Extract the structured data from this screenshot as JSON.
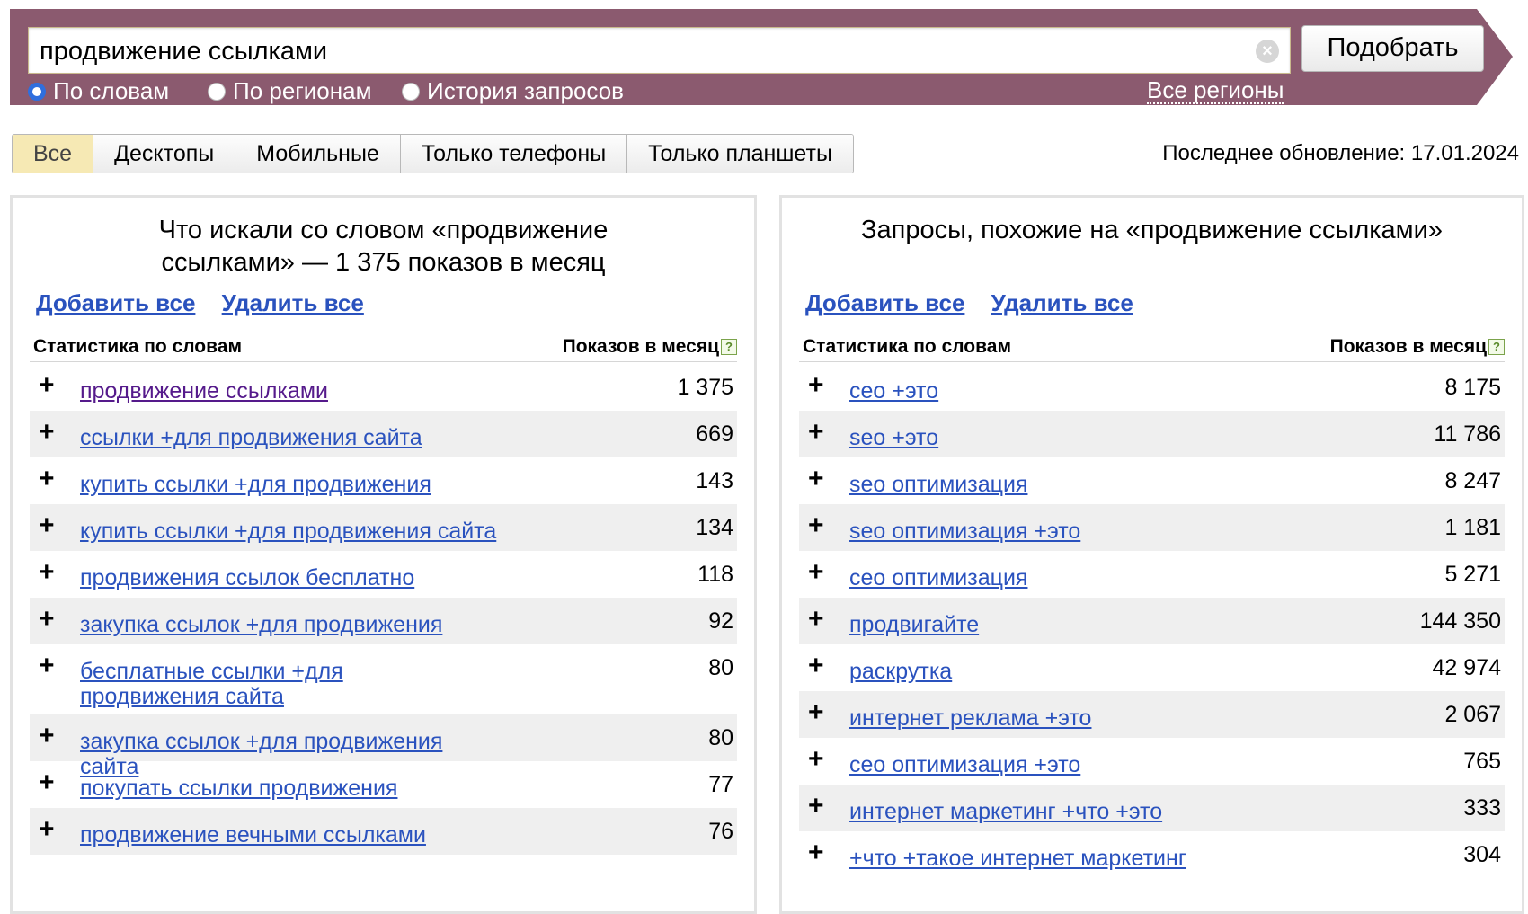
{
  "search": {
    "query": "продвижение ссылками",
    "button_label": "Подобрать",
    "regions_link": "Все регионы",
    "modes": [
      {
        "label": "По словам",
        "checked": true
      },
      {
        "label": "По регионам",
        "checked": false
      },
      {
        "label": "История запросов",
        "checked": false
      }
    ]
  },
  "device_tabs": [
    "Все",
    "Десктопы",
    "Мобильные",
    "Только телефоны",
    "Только планшеты"
  ],
  "last_update": "Последнее обновление: 17.01.2024",
  "colors": {
    "header_bg": "#8b5a6f",
    "link": "#2a52be",
    "visited_link": "#551a8b",
    "active_tab": "#f6e9b4"
  },
  "left_panel": {
    "title": "Что искали со словом «продвижение ссылками» — 1 375 показов в месяц",
    "add_all": "Добавить все",
    "remove_all": "Удалить все",
    "col_phrase": "Статистика по словам",
    "col_count": "Показов в месяц",
    "rows": [
      {
        "phrase": "продвижение ссылками",
        "count": "1 375"
      },
      {
        "phrase": "ссылки +для продвижения сайта",
        "count": "669"
      },
      {
        "phrase": "купить ссылки +для продвижения",
        "count": "143"
      },
      {
        "phrase": "купить ссылки +для продвижения сайта",
        "count": "134"
      },
      {
        "phrase": "продвижения ссылок бесплатно",
        "count": "118"
      },
      {
        "phrase": "закупка ссылок +для продвижения",
        "count": "92"
      },
      {
        "phrase": "бесплатные ссылки +для продвижения сайта",
        "count": "80"
      },
      {
        "phrase": "закупка ссылок +для продвижения сайта",
        "count": "80"
      },
      {
        "phrase": "покупать ссылки продвижения",
        "count": "77"
      },
      {
        "phrase": "продвижение вечными ссылками",
        "count": "76"
      }
    ]
  },
  "right_panel": {
    "title": "Запросы, похожие на «продвижение ссылками»",
    "add_all": "Добавить все",
    "remove_all": "Удалить все",
    "col_phrase": "Статистика по словам",
    "col_count": "Показов в месяц",
    "rows": [
      {
        "phrase": "сео +это",
        "count": "8 175"
      },
      {
        "phrase": "seo +это",
        "count": "11 786"
      },
      {
        "phrase": "seo оптимизация",
        "count": "8 247"
      },
      {
        "phrase": "seo оптимизация +это",
        "count": "1 181"
      },
      {
        "phrase": "сео оптимизация",
        "count": "5 271"
      },
      {
        "phrase": "продвигайте",
        "count": "144 350"
      },
      {
        "phrase": "раскрутка",
        "count": "42 974"
      },
      {
        "phrase": "интернет реклама +это",
        "count": "2 067"
      },
      {
        "phrase": "сео оптимизация +это",
        "count": "765"
      },
      {
        "phrase": "интернет маркетинг +что +это",
        "count": "333"
      },
      {
        "phrase": "+что +такое интернет маркетинг",
        "count": "304"
      }
    ]
  }
}
